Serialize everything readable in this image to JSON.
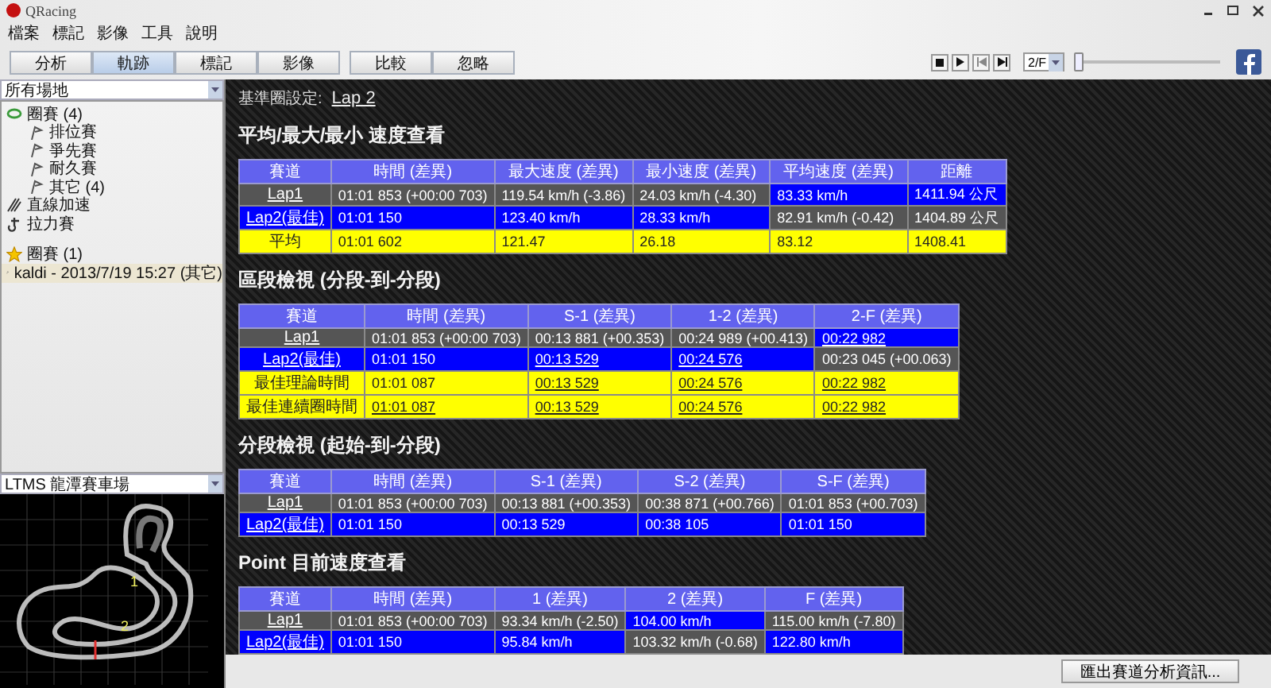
{
  "window": {
    "title": "QRacing"
  },
  "menu": [
    "檔案",
    "標記",
    "影像",
    "工具",
    "說明"
  ],
  "tabs": [
    {
      "label": "分析",
      "selected": false
    },
    {
      "label": "軌跡",
      "selected": true
    },
    {
      "label": "標記",
      "selected": false
    },
    {
      "label": "影像",
      "selected": false
    },
    {
      "label": "比較",
      "selected": false
    },
    {
      "label": "忽略",
      "selected": false
    }
  ],
  "player": {
    "speed": "2/F",
    "level": 0.0
  },
  "sidebar": {
    "venue": "所有場地",
    "tree": [
      {
        "label": "圈賽 (4)",
        "kind": "circuit",
        "selected": false,
        "children": [
          {
            "label": "排位賽",
            "kind": "session",
            "selected": false
          },
          {
            "label": "爭先賽",
            "kind": "session",
            "selected": false
          },
          {
            "label": "耐久賽",
            "kind": "session",
            "selected": false
          },
          {
            "label": "其它 (4)",
            "kind": "session",
            "selected": false
          }
        ]
      },
      {
        "label": "直線加速",
        "kind": "drag",
        "selected": false
      },
      {
        "label": "拉力賽",
        "kind": "rally",
        "selected": false
      },
      {
        "label": "圈賽 (1)",
        "kind": "star",
        "selected": false
      },
      {
        "label": "kaldi - 2013/7/19 15:27 (其它)",
        "kind": "session",
        "selected": true
      }
    ],
    "track": "LTMS 龍潭賽車場",
    "markers": [
      "1",
      "2"
    ]
  },
  "reference": {
    "label": "基準圈設定:",
    "value": "Lap 2"
  },
  "sections": [
    {
      "title": "平均/最大/最小 速度查看",
      "columns": [
        "賽道",
        "時間 (差異)",
        "最大速度 (差異)",
        "最小速度 (差異)",
        "平均速度 (差異)",
        "距離"
      ],
      "rows": [
        [
          {
            "text": "Lap1",
            "color": "#555555",
            "link": true
          },
          {
            "text": "01:01 853 (+00:00 703)",
            "color": "#555555",
            "link": false
          },
          {
            "text": "119.54 km/h (-3.86)",
            "color": "#555555",
            "link": false
          },
          {
            "text": "24.03 km/h (-4.30)",
            "color": "#555555",
            "link": false
          },
          {
            "text": "83.33 km/h",
            "color": "#0000ff",
            "link": false
          },
          {
            "text": "1411.94 公尺",
            "color": "#0000ff",
            "link": false
          }
        ],
        [
          {
            "text": "Lap2(最佳)",
            "color": "#0000ff",
            "link": true
          },
          {
            "text": "01:01 150",
            "color": "#0000ff",
            "link": false
          },
          {
            "text": "123.40 km/h",
            "color": "#0000ff",
            "link": false
          },
          {
            "text": "28.33 km/h",
            "color": "#0000ff",
            "link": false
          },
          {
            "text": "82.91 km/h (-0.42)",
            "color": "#555555",
            "link": false
          },
          {
            "text": "1404.89 公尺",
            "color": "#555555",
            "link": false
          }
        ],
        [
          {
            "text": "平均",
            "color": "#ffff00",
            "link": false
          },
          {
            "text": "01:01 602",
            "color": "#ffff00",
            "link": false
          },
          {
            "text": "121.47",
            "color": "#ffff00",
            "link": false
          },
          {
            "text": "26.18",
            "color": "#ffff00",
            "link": false
          },
          {
            "text": "83.12",
            "color": "#ffff00",
            "link": false
          },
          {
            "text": "1408.41",
            "color": "#ffff00",
            "link": false
          }
        ]
      ]
    },
    {
      "title": "區段檢視 (分段-到-分段)",
      "columns": [
        "賽道",
        "時間 (差異)",
        "S-1 (差異)",
        "1-2 (差異)",
        "2-F (差異)"
      ],
      "rows": [
        [
          {
            "text": "Lap1",
            "color": "#555555",
            "link": true
          },
          {
            "text": "01:01 853 (+00:00 703)",
            "color": "#555555",
            "link": false
          },
          {
            "text": "00:13 881 (+00.353)",
            "color": "#555555",
            "link": false
          },
          {
            "text": "00:24 989 (+00.413)",
            "color": "#555555",
            "link": false
          },
          {
            "text": "00:22 982",
            "color": "#0000ff",
            "link": true
          }
        ],
        [
          {
            "text": "Lap2(最佳)",
            "color": "#0000ff",
            "link": true
          },
          {
            "text": "01:01 150",
            "color": "#0000ff",
            "link": false
          },
          {
            "text": "00:13 529",
            "color": "#0000ff",
            "link": true
          },
          {
            "text": "00:24 576",
            "color": "#0000ff",
            "link": true
          },
          {
            "text": "00:23 045 (+00.063)",
            "color": "#555555",
            "link": false
          }
        ],
        [
          {
            "text": "最佳理論時間",
            "color": "#ffff00",
            "link": false
          },
          {
            "text": "01:01 087",
            "color": "#ffff00",
            "link": false
          },
          {
            "text": "00:13 529",
            "color": "#ffff00",
            "link": true
          },
          {
            "text": "00:24 576",
            "color": "#ffff00",
            "link": true
          },
          {
            "text": "00:22 982",
            "color": "#ffff00",
            "link": true
          }
        ],
        [
          {
            "text": "最佳連續圈時間",
            "color": "#ffff00",
            "link": false
          },
          {
            "text": "01:01 087",
            "color": "#ffff00",
            "link": true
          },
          {
            "text": "00:13 529",
            "color": "#ffff00",
            "link": true
          },
          {
            "text": "00:24 576",
            "color": "#ffff00",
            "link": true
          },
          {
            "text": "00:22 982",
            "color": "#ffff00",
            "link": true
          }
        ]
      ]
    },
    {
      "title": "分段檢視 (起始-到-分段)",
      "columns": [
        "賽道",
        "時間 (差異)",
        "S-1 (差異)",
        "S-2 (差異)",
        "S-F (差異)"
      ],
      "rows": [
        [
          {
            "text": "Lap1",
            "color": "#555555",
            "link": true
          },
          {
            "text": "01:01 853 (+00:00 703)",
            "color": "#555555",
            "link": false
          },
          {
            "text": "00:13 881 (+00.353)",
            "color": "#555555",
            "link": false
          },
          {
            "text": "00:38 871 (+00.766)",
            "color": "#555555",
            "link": false
          },
          {
            "text": "01:01 853 (+00.703)",
            "color": "#555555",
            "link": false
          }
        ],
        [
          {
            "text": "Lap2(最佳)",
            "color": "#0000ff",
            "link": true
          },
          {
            "text": "01:01 150",
            "color": "#0000ff",
            "link": false
          },
          {
            "text": "00:13 529",
            "color": "#0000ff",
            "link": false
          },
          {
            "text": "00:38 105",
            "color": "#0000ff",
            "link": false
          },
          {
            "text": "01:01 150",
            "color": "#0000ff",
            "link": false
          }
        ]
      ]
    },
    {
      "title": "Point 目前速度查看",
      "columns": [
        "賽道",
        "時間 (差異)",
        "1 (差異)",
        "2 (差異)",
        "F (差異)"
      ],
      "rows": [
        [
          {
            "text": "Lap1",
            "color": "#555555",
            "link": true
          },
          {
            "text": "01:01 853 (+00:00 703)",
            "color": "#555555",
            "link": false
          },
          {
            "text": "93.34 km/h (-2.50)",
            "color": "#555555",
            "link": false
          },
          {
            "text": "104.00 km/h",
            "color": "#0000ff",
            "link": false
          },
          {
            "text": "115.00 km/h (-7.80)",
            "color": "#555555",
            "link": false
          }
        ],
        [
          {
            "text": "Lap2(最佳)",
            "color": "#0000ff",
            "link": true
          },
          {
            "text": "01:01 150",
            "color": "#0000ff",
            "link": false
          },
          {
            "text": "95.84 km/h",
            "color": "#0000ff",
            "link": false
          },
          {
            "text": "103.32 km/h (-0.68)",
            "color": "#555555",
            "link": false
          },
          {
            "text": "122.80 km/h",
            "color": "#0000ff",
            "link": false
          }
        ]
      ]
    }
  ],
  "export_button": "匯出賽道分析資訊..."
}
